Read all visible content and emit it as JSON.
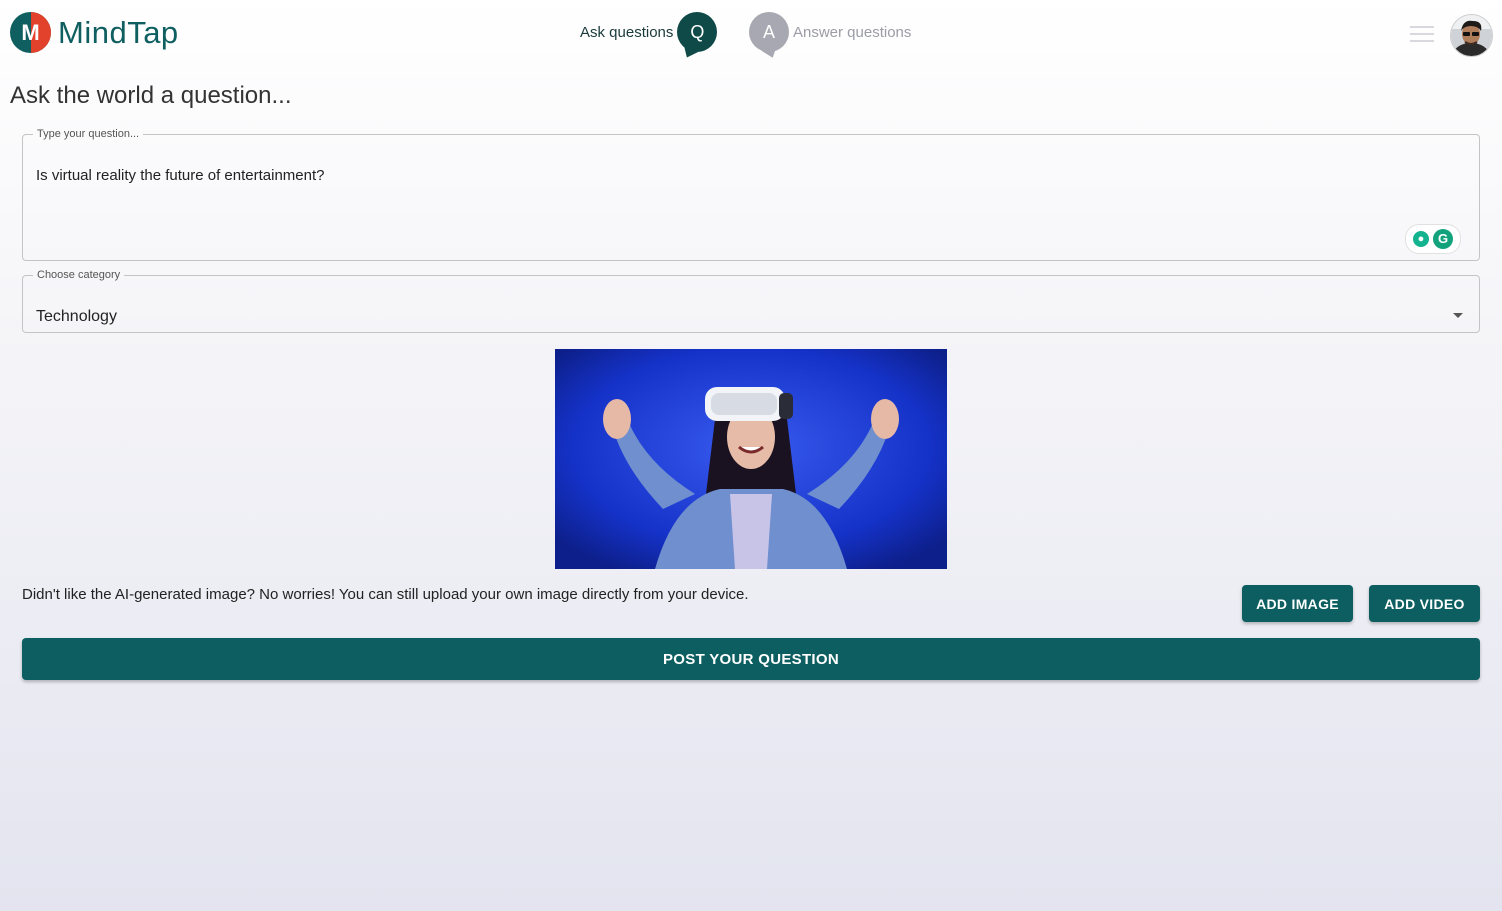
{
  "app": {
    "logo_letter": "M",
    "name": "MindTap"
  },
  "nav": {
    "ask": {
      "label": "Ask questions",
      "badge": "Q"
    },
    "answer": {
      "label": "Answer questions",
      "badge": "A"
    }
  },
  "header": {
    "menu_icon": "hamburger-icon",
    "avatar_icon": "user-avatar"
  },
  "page": {
    "title": "Ask the world a question..."
  },
  "question": {
    "legend": "Type your question...",
    "value": "Is virtual reality the future of entertainment?",
    "assist_icons": [
      "lightbulb-icon",
      "grammarly-icon"
    ],
    "grammarly_letter": "G"
  },
  "category": {
    "legend": "Choose category",
    "value": "Technology"
  },
  "preview": {
    "alt": "AI-generated image of a woman wearing a VR headset with raised hands on blue background"
  },
  "hint": "Didn't like the AI-generated image? No worries! You can still upload your own image directly from your device.",
  "buttons": {
    "add_image": "ADD IMAGE",
    "add_video": "ADD VIDEO",
    "post": "POST YOUR QUESTION"
  },
  "colors": {
    "brand_teal": "#0d5e60",
    "brand_red": "#e2412b",
    "preview_bg": "#1f3fd8"
  }
}
